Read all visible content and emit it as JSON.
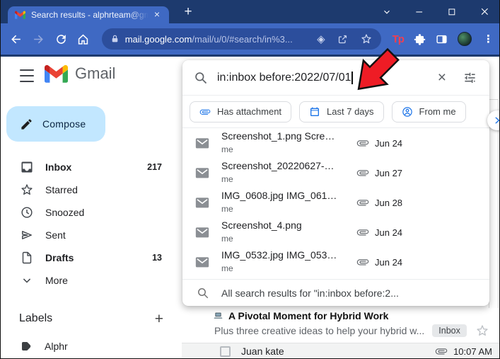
{
  "icons": {
    "close": "×",
    "plus": "+",
    "overflow": "⋮",
    "diamond": "◈"
  },
  "browser": {
    "tab_title": "Search results - alphrteam@gmai",
    "url_host": "mail.google.com",
    "url_path": "/mail/u/0/#search/in%3...",
    "tp_badge": "Tp"
  },
  "gmail": {
    "wordmark": "Gmail",
    "search": {
      "query": "in:inbox before:2022/07/01"
    },
    "chips": [
      {
        "label": "Has attachment"
      },
      {
        "label": "Last 7 days"
      },
      {
        "label": "From me"
      }
    ],
    "suggestions": [
      {
        "title": "Screenshot_1.png Scre…",
        "sender": "me",
        "date": "Jun 24"
      },
      {
        "title": "Screenshot_20220627-…",
        "sender": "me",
        "date": "Jun 27"
      },
      {
        "title": "IMG_0608.jpg IMG_061…",
        "sender": "me",
        "date": "Jun 28"
      },
      {
        "title": "Screenshot_4.png",
        "sender": "me",
        "date": "Jun 24"
      },
      {
        "title": "IMG_0532.jpg IMG_053…",
        "sender": "me",
        "date": "Jun 24"
      }
    ],
    "all_results": "All search results for \"in:inbox before:2...",
    "sidebar": {
      "compose": "Compose",
      "items": [
        {
          "label": "Inbox",
          "count": "217"
        },
        {
          "label": "Starred"
        },
        {
          "label": "Snoozed"
        },
        {
          "label": "Sent"
        },
        {
          "label": "Drafts",
          "count": "13"
        },
        {
          "label": "More"
        }
      ],
      "labels_header": "Labels",
      "labels": [
        {
          "name": "Alphr"
        }
      ]
    },
    "emails": [
      {
        "emoji": "💻",
        "title": "A Pivotal Moment for Hybrid Work",
        "snippet": "Plus three creative ideas to help your hybrid w...",
        "badge": "Inbox"
      },
      {
        "sender": "Juan kate",
        "time": "10:07 AM"
      }
    ]
  },
  "colors": {
    "chrome_titlebar": "#1d3a6e",
    "chrome_frame": "#3f69c3",
    "address_pill": "#2c4e9c",
    "accent_blue": "#1a73e8",
    "compose_bg": "#c2e7ff",
    "arrow_red": "#ee1c25"
  }
}
